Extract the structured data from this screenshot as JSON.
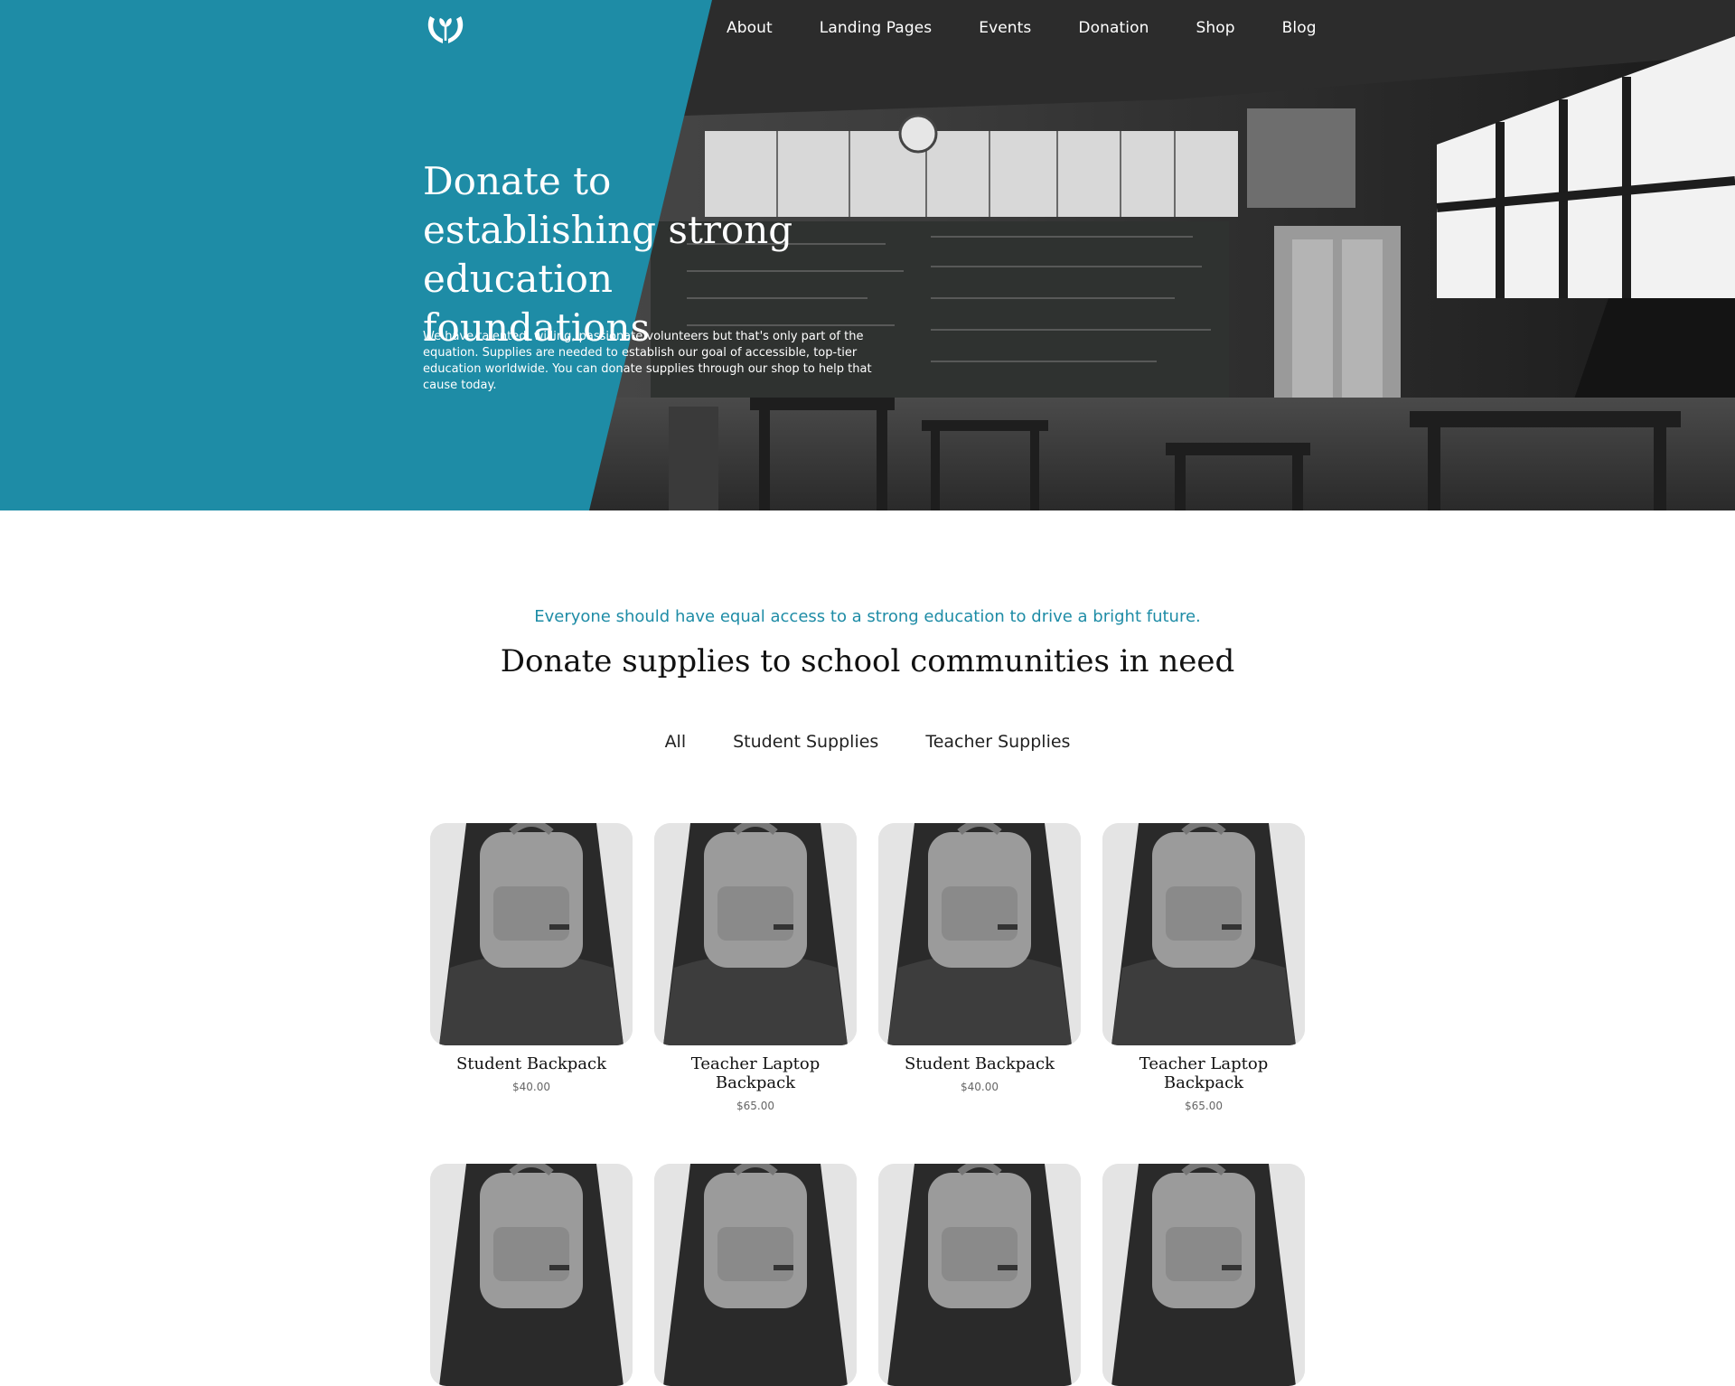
{
  "nav": {
    "logo_icon": "hands-sprout-logo-icon",
    "links": [
      "About",
      "Landing Pages",
      "Events",
      "Donation",
      "Shop",
      "Blog"
    ]
  },
  "hero": {
    "title": "Donate to establishing strong education foundations",
    "body": "We have talented, willing, passionate volunteers but that's only part of the equation. Supplies are needed to establish our goal of accessible, top-tier education worldwide. You can donate supplies through our shop to help that cause today.",
    "accent_color": "#1e8ca6"
  },
  "section": {
    "tagline": "Everyone should have equal access to a strong education to drive a bright future.",
    "title": "Donate supplies to school communities in need",
    "filters": [
      "All",
      "Student Supplies",
      "Teacher Supplies"
    ]
  },
  "products": [
    {
      "name": "Student Backpack",
      "price": "$40.00"
    },
    {
      "name": "Teacher Laptop Backpack",
      "price": "$65.00"
    },
    {
      "name": "Student Backpack",
      "price": "$40.00"
    },
    {
      "name": "Teacher Laptop Backpack",
      "price": "$65.00"
    }
  ]
}
